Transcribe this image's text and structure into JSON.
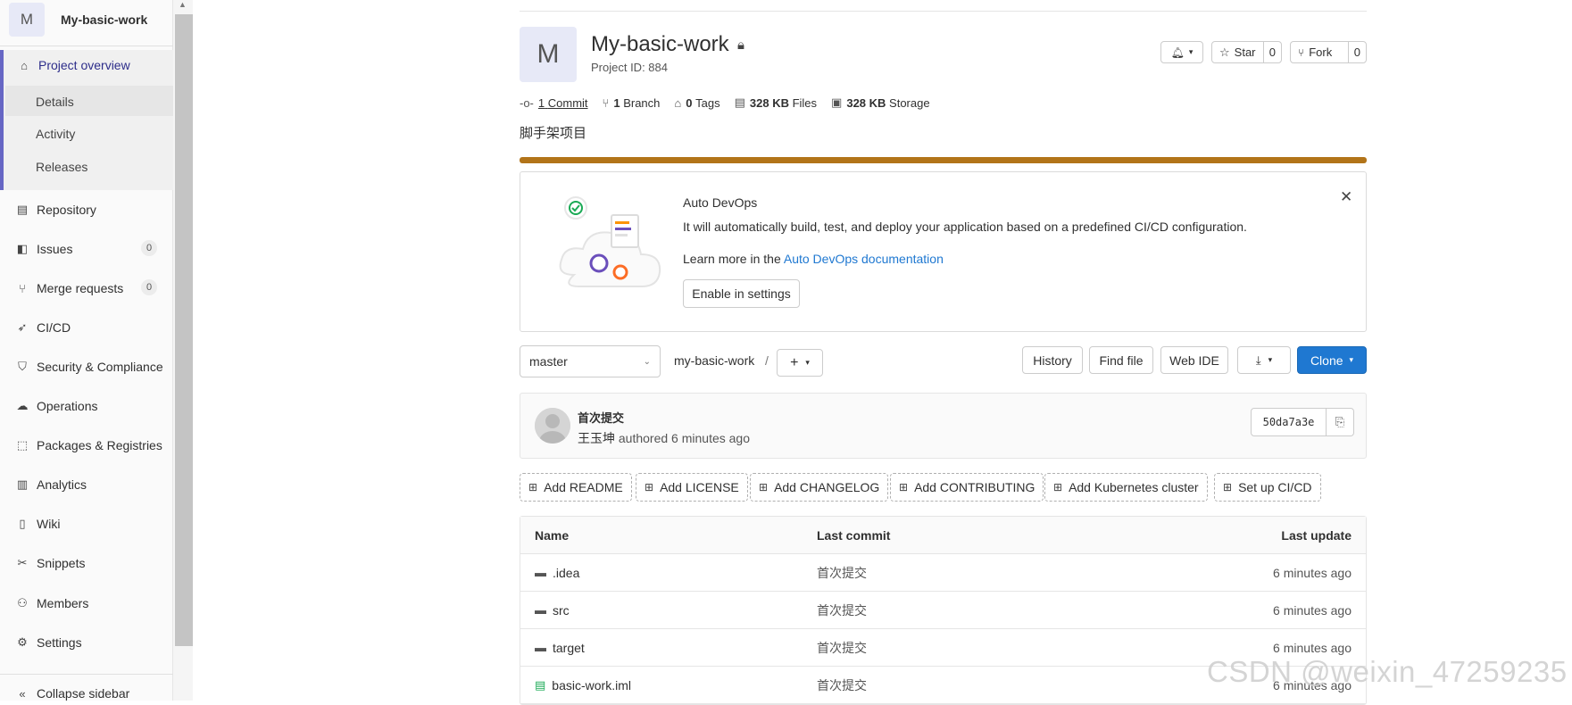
{
  "sidebar": {
    "project_initial": "M",
    "project_name": "My-basic-work",
    "project_overview": "Project overview",
    "sub": [
      "Details",
      "Activity",
      "Releases"
    ],
    "items": [
      {
        "label": "Repository"
      },
      {
        "label": "Issues",
        "count": "0"
      },
      {
        "label": "Merge requests",
        "count": "0"
      },
      {
        "label": "CI/CD"
      },
      {
        "label": "Security & Compliance"
      },
      {
        "label": "Operations"
      },
      {
        "label": "Packages & Registries"
      },
      {
        "label": "Analytics"
      },
      {
        "label": "Wiki"
      },
      {
        "label": "Snippets"
      },
      {
        "label": "Members"
      },
      {
        "label": "Settings"
      }
    ],
    "collapse": "Collapse sidebar"
  },
  "project": {
    "initial": "M",
    "title": "My-basic-work",
    "id": "Project ID: 884",
    "star": "Star",
    "star_count": "0",
    "fork": "Fork",
    "fork_count": "0",
    "stats": {
      "commits_num": "1",
      "commits_label": "Commit",
      "branch_num": "1",
      "branch_label": "Branch",
      "tags_num": "0",
      "tags_label": "Tags",
      "files_num": "328 KB",
      "files_label": "Files",
      "storage_num": "328 KB",
      "storage_label": "Storage"
    },
    "description": "脚手架项目"
  },
  "devops": {
    "title": "Auto DevOps",
    "text": "It will automatically build, test, and deploy your application based on a predefined CI/CD configuration.",
    "learn": "Learn more in the ",
    "learn_link": "Auto DevOps documentation",
    "enable": "Enable in settings"
  },
  "repo": {
    "branch": "master",
    "path": "my-basic-work",
    "separator": "/",
    "history": "History",
    "find_file": "Find file",
    "web_ide": "Web IDE",
    "clone": "Clone"
  },
  "commit": {
    "title": "首次提交",
    "author": "王玉坤",
    "authored": " authored 6 minutes ago",
    "sha": "50da7a3e"
  },
  "add_buttons": [
    "Add README",
    "Add LICENSE",
    "Add CHANGELOG",
    "Add CONTRIBUTING",
    "Add Kubernetes cluster",
    "Set up CI/CD"
  ],
  "table": {
    "headers": {
      "name": "Name",
      "commit": "Last commit",
      "update": "Last update"
    },
    "rows": [
      {
        "name": ".idea",
        "type": "folder",
        "commit": "首次提交",
        "update": "6 minutes ago"
      },
      {
        "name": "src",
        "type": "folder",
        "commit": "首次提交",
        "update": "6 minutes ago"
      },
      {
        "name": "target",
        "type": "folder",
        "commit": "首次提交",
        "update": "6 minutes ago"
      },
      {
        "name": "basic-work.iml",
        "type": "file",
        "commit": "首次提交",
        "update": "6 minutes ago"
      }
    ]
  },
  "watermark": "CSDN @weixin_47259235"
}
